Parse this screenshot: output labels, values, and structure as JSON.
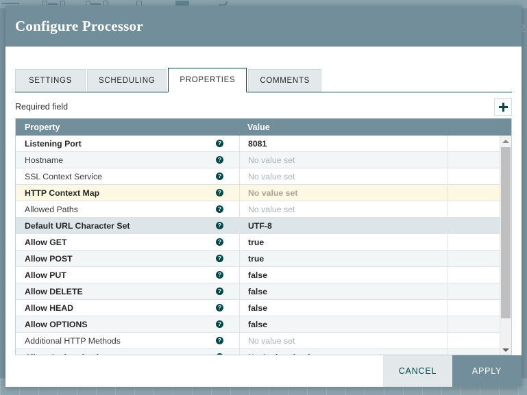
{
  "window": {
    "title": "Configure Processor"
  },
  "canvas": {
    "right_edge_label": "2"
  },
  "tabs": [
    {
      "label": "SETTINGS",
      "active": false
    },
    {
      "label": "SCHEDULING",
      "active": false
    },
    {
      "label": "PROPERTIES",
      "active": true
    },
    {
      "label": "COMMENTS",
      "active": false
    }
  ],
  "toolbar": {
    "required_field_label": "Required field",
    "add_property_icon": "plus-icon"
  },
  "table": {
    "columns": [
      "Property",
      "Value"
    ],
    "help_icon": "help-circle-icon",
    "unset_placeholder": "No value set",
    "rows": [
      {
        "name": "Listening Port",
        "value": "8081",
        "required": true,
        "unset": false,
        "state": "normal"
      },
      {
        "name": "Hostname",
        "value": "No value set",
        "required": false,
        "unset": true,
        "state": "alt"
      },
      {
        "name": "SSL Context Service",
        "value": "No value set",
        "required": false,
        "unset": true,
        "state": "normal"
      },
      {
        "name": "HTTP Context Map",
        "value": "No value set",
        "required": true,
        "unset": true,
        "state": "invalid"
      },
      {
        "name": "Allowed Paths",
        "value": "No value set",
        "required": false,
        "unset": true,
        "state": "normal"
      },
      {
        "name": "Default URL Character Set",
        "value": "UTF-8",
        "required": true,
        "unset": false,
        "state": "selected"
      },
      {
        "name": "Allow GET",
        "value": "true",
        "required": true,
        "unset": false,
        "state": "normal"
      },
      {
        "name": "Allow POST",
        "value": "true",
        "required": true,
        "unset": false,
        "state": "alt"
      },
      {
        "name": "Allow PUT",
        "value": "false",
        "required": true,
        "unset": false,
        "state": "normal"
      },
      {
        "name": "Allow DELETE",
        "value": "false",
        "required": true,
        "unset": false,
        "state": "alt"
      },
      {
        "name": "Allow HEAD",
        "value": "false",
        "required": true,
        "unset": false,
        "state": "normal"
      },
      {
        "name": "Allow OPTIONS",
        "value": "false",
        "required": true,
        "unset": false,
        "state": "alt"
      },
      {
        "name": "Additional HTTP Methods",
        "value": "No value set",
        "required": false,
        "unset": true,
        "state": "normal"
      },
      {
        "name": "Client Authentication",
        "value": "No Authentication",
        "required": true,
        "unset": false,
        "state": "alt"
      }
    ]
  },
  "scrollbar": {
    "up_icon": "caret-up-icon",
    "down_icon": "caret-down-icon"
  },
  "footer": {
    "cancel_label": "CANCEL",
    "apply_label": "APPLY"
  },
  "colors": {
    "header_slate": "#728e9b",
    "accent_teal": "#004849",
    "invalid_row": "#fdf8e3",
    "selected_row": "#dde5e9",
    "alt_row": "#f3f6f7"
  }
}
